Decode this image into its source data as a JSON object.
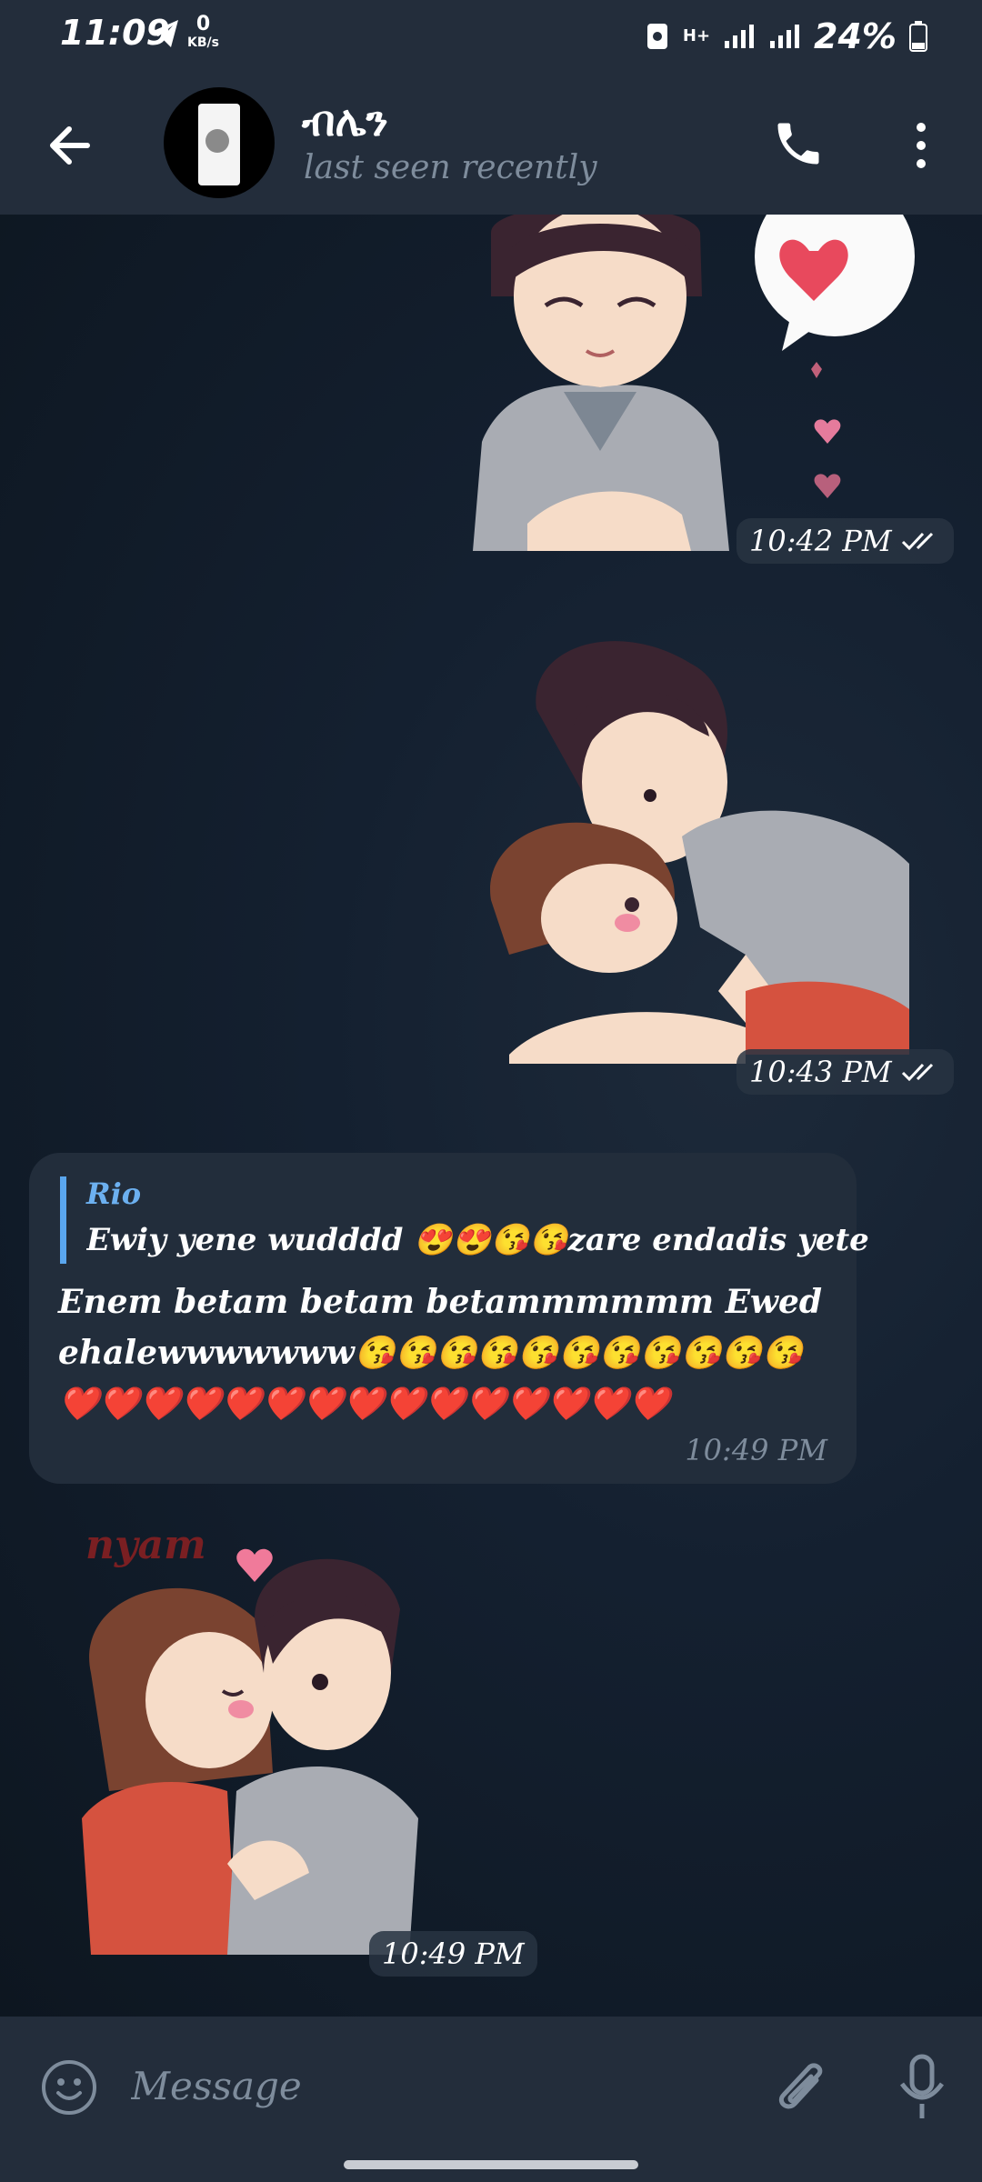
{
  "status_bar": {
    "time": "11:09",
    "net_speed_value": "0",
    "net_speed_unit": "KB/s",
    "network_type": "H+",
    "battery": "24%"
  },
  "header": {
    "title": "ብሌን",
    "subtitle": "last seen recently"
  },
  "messages": [
    {
      "type": "sticker",
      "time": "10:42 PM",
      "read": true
    },
    {
      "type": "sticker",
      "time": "10:43 PM",
      "read": true
    },
    {
      "type": "text",
      "reply_name": "Rio",
      "reply_text": "Ewiy yene wudddd 😍😍😘😘zare endadis yetewele...",
      "text": "Enem betam betam betammmmmm Ewedehalewwwwwww😘😘😘😘😘😘😘😘😘😘😘❤️❤️❤️❤️❤️❤️❤️❤️❤️❤️❤️❤️❤️❤️❤️",
      "time": "10:49 PM"
    },
    {
      "type": "sticker",
      "time": "10:49 PM",
      "caption": "nyam"
    }
  ],
  "input": {
    "placeholder": "Message"
  },
  "icons": {
    "back": "arrow-left-icon",
    "call": "phone-icon",
    "more": "more-vertical-icon",
    "emoji": "emoji-icon",
    "attach": "paperclip-icon",
    "mic": "microphone-icon"
  },
  "colors": {
    "header_bg": "#232d3b",
    "chat_bg": "#0f1722",
    "bubble_bg": "#222d3b",
    "accent": "#5aa6ee"
  }
}
